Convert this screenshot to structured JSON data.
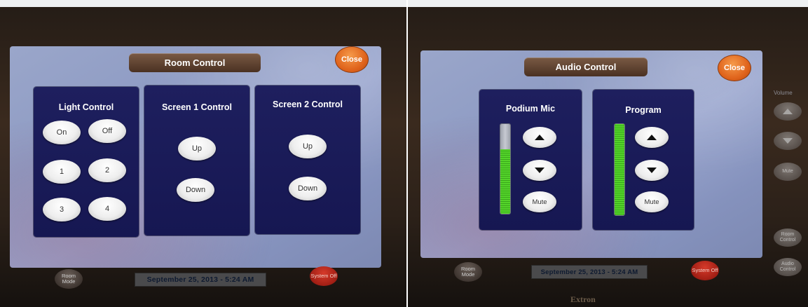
{
  "left_panel": {
    "title": "Room Control",
    "close_label": "Close",
    "light_control": {
      "title": "Light Control",
      "buttons": [
        "On",
        "Off",
        "1",
        "2",
        "3",
        "4"
      ]
    },
    "screen1": {
      "title": "Screen 1 Control",
      "up_label": "Up",
      "down_label": "Down"
    },
    "screen2": {
      "title": "Screen 2 Control",
      "up_label": "Up",
      "down_label": "Down"
    },
    "footer": {
      "room_mode_label": "Room Mode",
      "date_time": "September 25, 2013  -  5:24 AM",
      "system_off_label": "System Off"
    }
  },
  "right_panel": {
    "title": "Audio Control",
    "close_label": "Close",
    "podium_mic": {
      "title": "Podium Mic",
      "mute_label": "Mute",
      "level": 0.72
    },
    "program": {
      "title": "Program",
      "mute_label": "Mute",
      "level": 1.0
    },
    "footer": {
      "room_mode_label": "Room Mode",
      "date_time": "September 25, 2013  -  5:24 AM",
      "system_off_label": "System Off"
    },
    "side": {
      "volume_label": "Volume",
      "mute_label": "Mute",
      "room_control_label": "Room Control",
      "audio_control_label": "Audio Control"
    },
    "brand": "Extron"
  },
  "colors": {
    "screen_bg": "#9aa6ca",
    "panel_bg": "#1e1f5e",
    "close_orange": "#e0641c",
    "title_brown": "#5a3d2b",
    "meter_green": "#54d42a"
  },
  "icons": {
    "volume_up": "triangle-up-icon",
    "volume_down": "triangle-down-icon"
  }
}
